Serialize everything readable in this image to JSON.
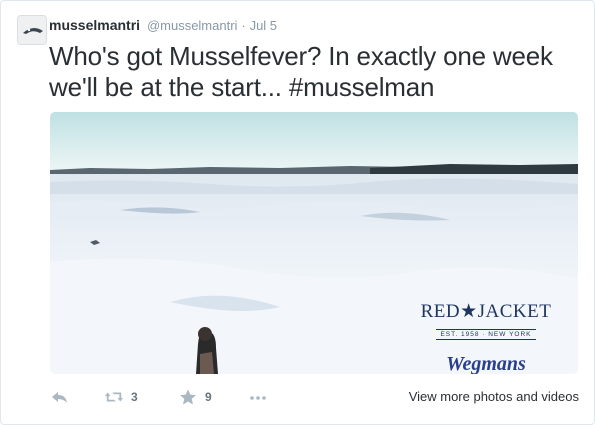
{
  "tweet": {
    "author": {
      "name": "musselmantri",
      "handle": "@musselmantri",
      "separator": "·",
      "time": "Jul 5"
    },
    "text_prefix": "Who's got Musselfever? In exactly one week we'll be at the start... ",
    "hashtag": "#musselman",
    "media": {
      "sponsor_1": "RED★JACKET",
      "sponsor_1_sub": "EST. 1958 · NEW YORK",
      "sponsor_2": "Wegmans"
    },
    "actions": {
      "reply_icon": "reply-icon",
      "retweet_icon": "retweet-icon",
      "retweet_count": "3",
      "favorite_icon": "star-icon",
      "favorite_count": "9",
      "more_icon": "more-dots-icon",
      "view_more_label": "View more photos and videos"
    }
  },
  "colors": {
    "text": "#292f33",
    "muted": "#8899a6",
    "action_icon": "#aab8c2",
    "brand_navy": "#1e3563"
  }
}
